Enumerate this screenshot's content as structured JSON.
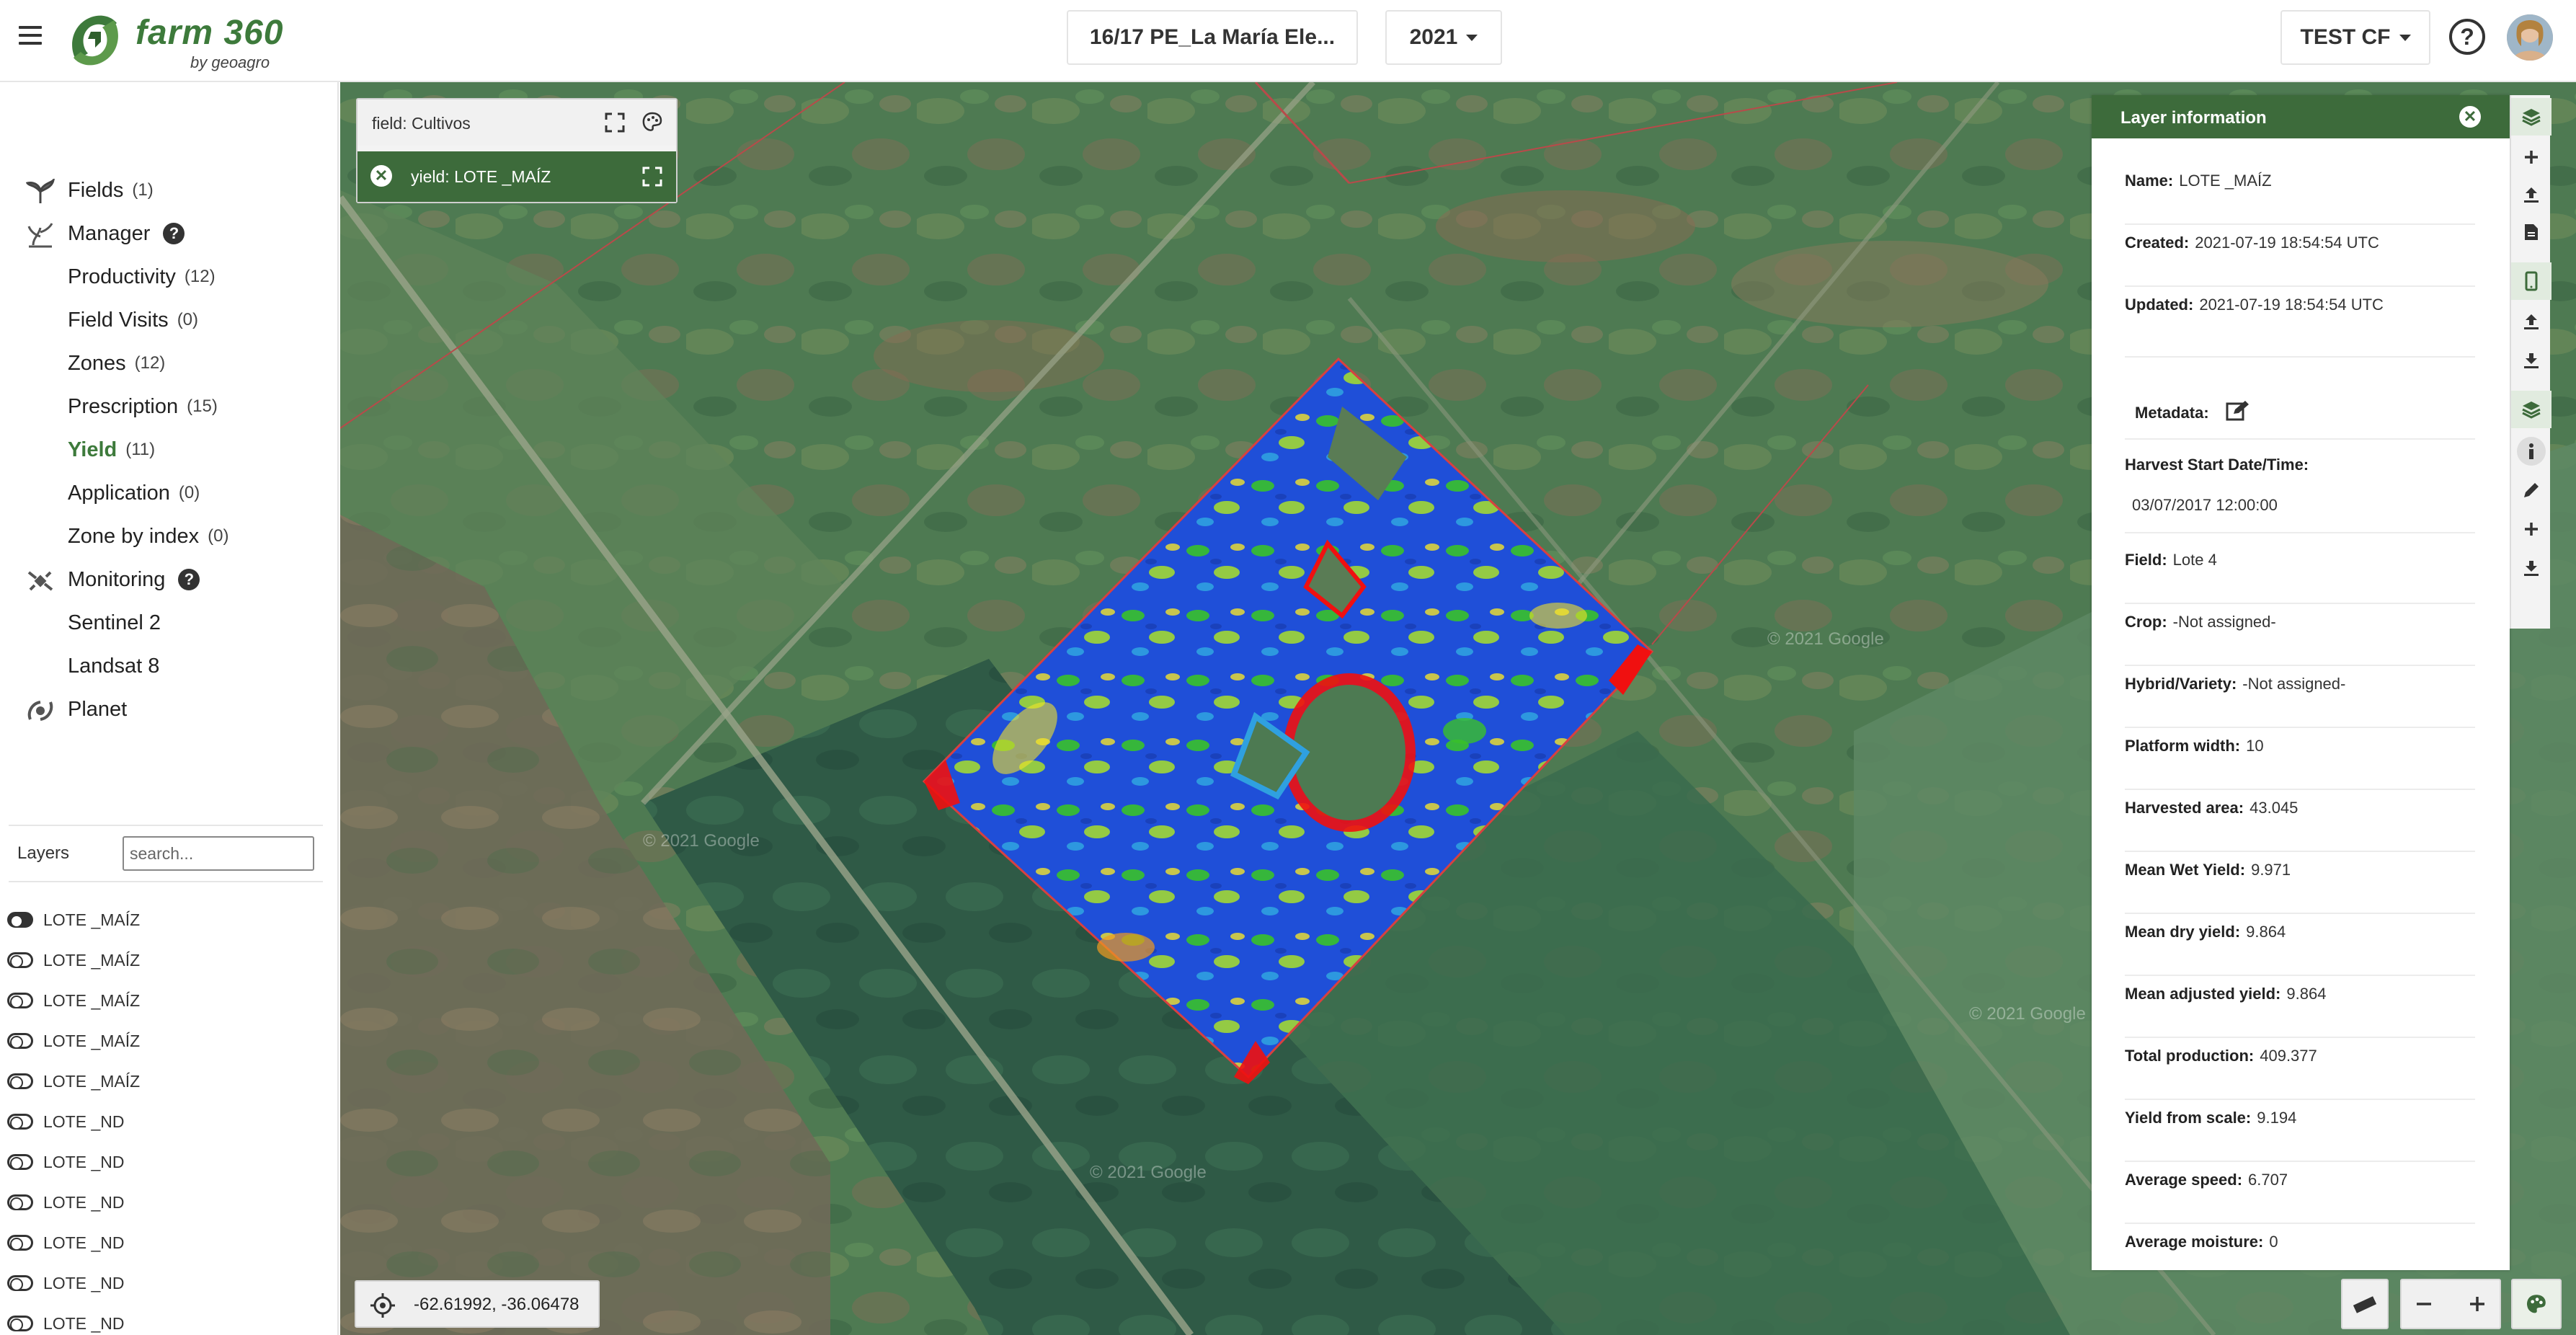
{
  "header": {
    "app_name": "farm 360",
    "app_sub": "by geoagro",
    "season_select": "16/17 PE_La María Ele...",
    "year_select": "2021",
    "account_select": "TEST CF",
    "help_label": "?"
  },
  "sidebar": {
    "items": [
      {
        "label": "Fields",
        "count": "(1)"
      },
      {
        "label": "Manager",
        "count": ""
      },
      {
        "label": "Productivity",
        "count": "(12)"
      },
      {
        "label": "Field Visits",
        "count": "(0)"
      },
      {
        "label": "Zones",
        "count": "(12)"
      },
      {
        "label": "Prescription",
        "count": "(15)"
      },
      {
        "label": "Yield",
        "count": "(11)"
      },
      {
        "label": "Application",
        "count": "(0)"
      },
      {
        "label": "Zone by index",
        "count": "(0)"
      },
      {
        "label": "Monitoring",
        "count": ""
      },
      {
        "label": "Sentinel 2",
        "count": ""
      },
      {
        "label": "Landsat 8",
        "count": ""
      },
      {
        "label": "Planet",
        "count": ""
      }
    ],
    "help_badge": "?"
  },
  "layers": {
    "label": "Layers",
    "search_placeholder": "search...",
    "items": [
      "LOTE _MAÍZ",
      "LOTE _MAÍZ",
      "LOTE _MAÍZ",
      "LOTE _MAÍZ",
      "LOTE _MAÍZ",
      "LOTE _ND",
      "LOTE _ND",
      "LOTE _ND",
      "LOTE _ND",
      "LOTE _ND",
      "LOTE _ND"
    ]
  },
  "map": {
    "field_layer": "field: Cultivos",
    "yield_layer": "yield: LOTE _MAÍZ",
    "coordinates": "-62.61992, -36.06478",
    "watermarks": [
      "© 2021 Google",
      "© 2021 Google",
      "© 2021 Google",
      "© 2021 Google"
    ]
  },
  "info": {
    "title": "Layer information",
    "close": "✕",
    "name_k": "Name:",
    "name_v": "LOTE _MAÍZ",
    "created_k": "Created:",
    "created_v": "2021-07-19 18:54:54 UTC",
    "updated_k": "Updated:",
    "updated_v": "2021-07-19 18:54:54 UTC",
    "metadata_k": "Metadata:",
    "harvest_k": "Harvest Start Date/Time:",
    "harvest_v": "03/07/2017 12:00:00",
    "field_k": "Field:",
    "field_v": "Lote 4",
    "crop_k": "Crop:",
    "crop_v": "-Not assigned-",
    "hybrid_k": "Hybrid/Variety:",
    "hybrid_v": "-Not assigned-",
    "platform_k": "Platform width:",
    "platform_v": "10",
    "area_k": "Harvested area:",
    "area_v": "43.045",
    "wet_k": "Mean Wet Yield:",
    "wet_v": "9.971",
    "dry_k": "Mean dry yield:",
    "dry_v": "9.864",
    "adj_k": "Mean adjusted yield:",
    "adj_v": "9.864",
    "prod_k": "Total production:",
    "prod_v": "409.377",
    "scale_k": "Yield from scale:",
    "scale_v": "9.194",
    "speed_k": "Average speed:",
    "speed_v": "6.707",
    "moist_k": "Average moisture:",
    "moist_v": "0"
  },
  "colors": {
    "brand_green": "#3d6b3b",
    "logo_green": "#3d7a3b",
    "yield_low": "#1f4fd8",
    "yield_mid": "#39c12a",
    "yield_high": "#f01010"
  },
  "icons": [
    "menu-icon",
    "farm360-logo-icon",
    "fields-icon",
    "manager-icon",
    "monitoring-icon",
    "planet-icon",
    "toggle-icon",
    "expand-icon",
    "palette-icon",
    "close-icon",
    "locate-icon",
    "layers-icon",
    "plus-icon",
    "upload-icon",
    "file-icon",
    "mobile-icon",
    "download-icon",
    "info-icon",
    "pencil-icon",
    "ruler-icon",
    "minus-icon",
    "edit-icon"
  ]
}
